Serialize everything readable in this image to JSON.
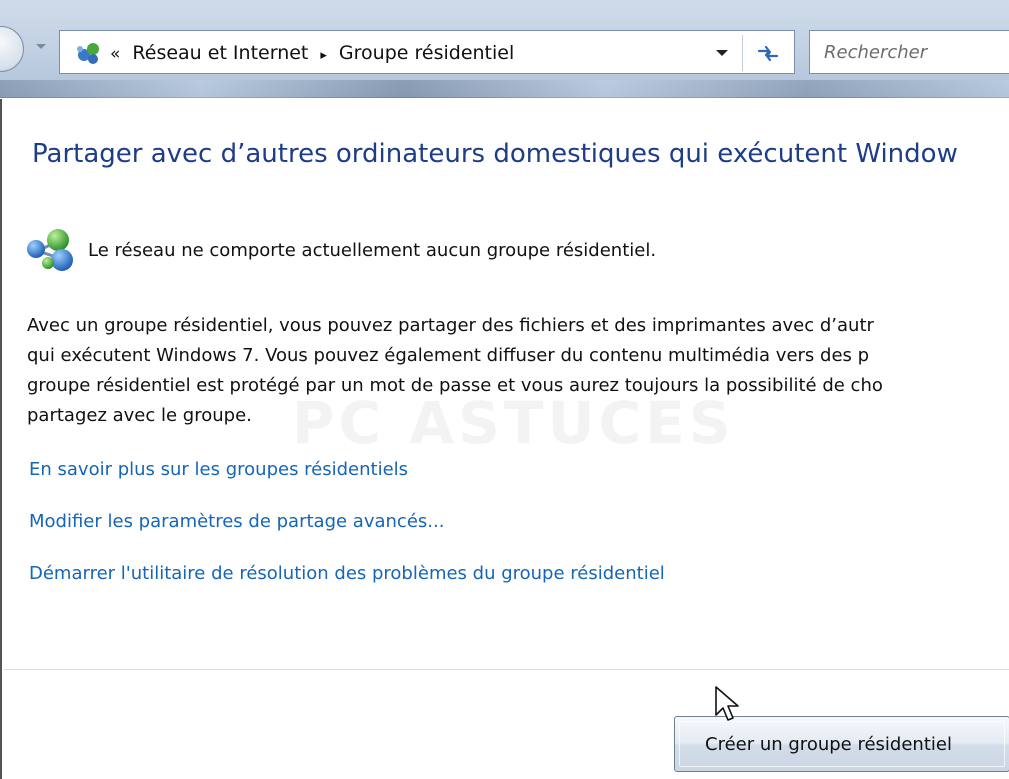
{
  "address_bar": {
    "overflow_chevron": "«",
    "crumbs": [
      "Réseau et Internet",
      "Groupe résidentiel"
    ],
    "separator": "▸",
    "icon": "network-globe-icon"
  },
  "search": {
    "placeholder": "Rechercher"
  },
  "page": {
    "title": "Partager avec d’autres ordinateurs domestiques qui exécutent Window",
    "status": "Le réseau ne comporte actuellement aucun groupe résidentiel.",
    "status_icon": "homegroup-network-icon",
    "description_lines": [
      "Avec un groupe résidentiel, vous pouvez partager des fichiers et des imprimantes avec d’autr",
      "qui exécutent Windows 7. Vous pouvez également diffuser du contenu multimédia vers des p",
      "groupe résidentiel est protégé par un mot de passe et vous aurez toujours la possibilité de cho",
      "partagez avec le groupe."
    ],
    "links": [
      "En savoir plus sur les groupes résidentiels",
      "Modifier les paramètres de partage avancés...",
      "Démarrer l'utilitaire de résolution des problèmes du groupe résidentiel"
    ],
    "create_button": "Créer un groupe résidentiel"
  },
  "watermark": "PC ASTUCES",
  "colors": {
    "title": "#1e3d88",
    "link": "#1565b9",
    "text": "#111111"
  }
}
